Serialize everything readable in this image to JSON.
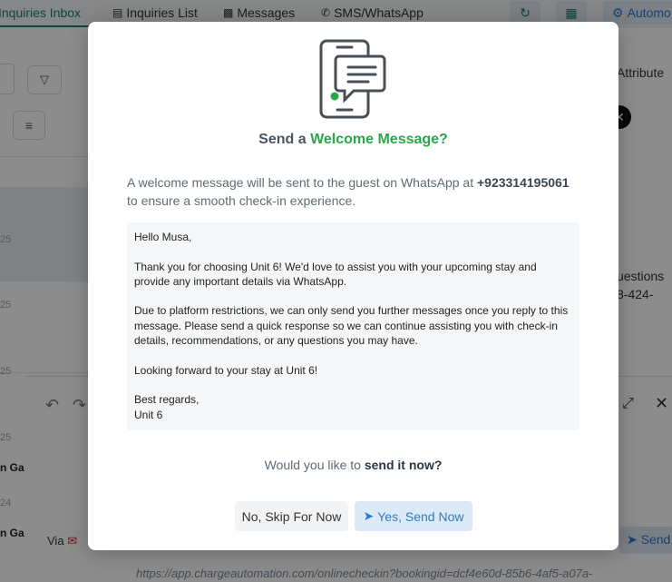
{
  "tabs": [
    {
      "label": "Inquiries Inbox",
      "icon": "inbox-icon"
    },
    {
      "label": "Inquiries List",
      "icon": "list-icon"
    },
    {
      "label": "Messages",
      "icon": "chat-icon"
    },
    {
      "label": "SMS/WhatsApp",
      "icon": "whatsapp-icon"
    }
  ],
  "top_actions": {
    "automation_label": "Automo"
  },
  "background": {
    "right_attribute": "Attribute",
    "right_questions": "uestions",
    "right_phone_fragment": "8-424-",
    "list_dates": [
      "25",
      "25",
      "25",
      "25",
      "24"
    ],
    "list_names": [
      "n Ga",
      "n Ga"
    ],
    "via_label": "Via",
    "send_label": "Send",
    "link_text": "https://app.chargeautomation.com/onlinecheckin?bookingid=dcf4e60d-85b6-4af5-a07a-"
  },
  "modal": {
    "title_prefix": "Send a ",
    "title_accent": "Welcome Message?",
    "intro_before": "A welcome message will be sent to the guest on WhatsApp at ",
    "intro_phone": "+923314195061",
    "intro_after": " to ensure a smooth check-in experience.",
    "message_paragraphs": [
      "Hello Musa,",
      "Thank you for choosing Unit 6! We'd love to assist you with your upcoming stay and provide any important details via WhatsApp.",
      "Due to platform restrictions, we can only send you further messages once you reply to this message. Please send a quick response so we can continue assisting you with check-in details, recommendations, or any questions you may have.",
      "Looking forward to your stay at Unit 6!",
      "Best regards,\nUnit 6"
    ],
    "question_prefix": "Would you like to ",
    "question_strong": "send it now?",
    "skip_button": "No, Skip For Now",
    "send_button": "Yes, Send Now"
  },
  "colors": {
    "accent_green": "#27a84a",
    "primary_blue": "#3179c4",
    "tab_active": "#1a7f6b"
  }
}
